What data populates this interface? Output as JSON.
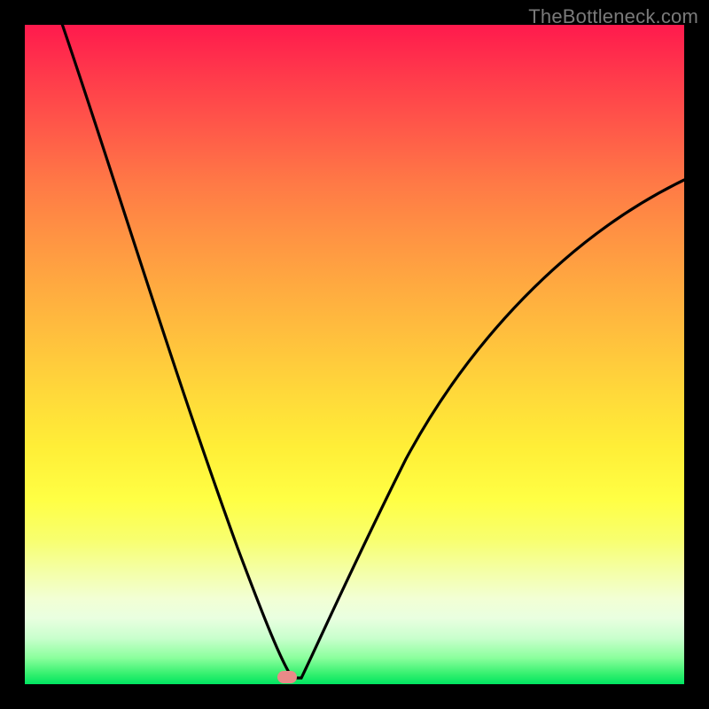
{
  "watermark": "TheBottleneck.com",
  "chart_data": {
    "type": "line",
    "title": "",
    "xlabel": "",
    "ylabel": "",
    "xlim": [
      0,
      100
    ],
    "ylim": [
      0,
      100
    ],
    "grid": false,
    "series": [
      {
        "name": "bottleneck-curve",
        "x": [
          0,
          4,
          8,
          12,
          16,
          20,
          24,
          28,
          32,
          35,
          37,
          39,
          40.5,
          42,
          44,
          47,
          51,
          56,
          62,
          70,
          80,
          92,
          100
        ],
        "y": [
          120,
          106,
          92,
          79,
          66,
          54,
          42.5,
          32,
          22,
          14,
          9,
          4.5,
          1.2,
          2.5,
          7,
          15,
          25,
          36,
          46.5,
          56,
          64.5,
          72,
          76
        ]
      }
    ],
    "interior_box": {
      "x": 3.5,
      "y": 3.5,
      "w": 93,
      "h": 93
    },
    "marker": {
      "x": 40.5,
      "y": 1.2,
      "shape": "rounded-rect",
      "color": "#e98a88"
    },
    "colors": {
      "frame_border": "#000000",
      "gradient_top": "#ff1a4d",
      "gradient_bottom": "#00e561",
      "curve": "#000000",
      "marker": "#e98a88",
      "watermark": "#7a7a7a"
    }
  }
}
